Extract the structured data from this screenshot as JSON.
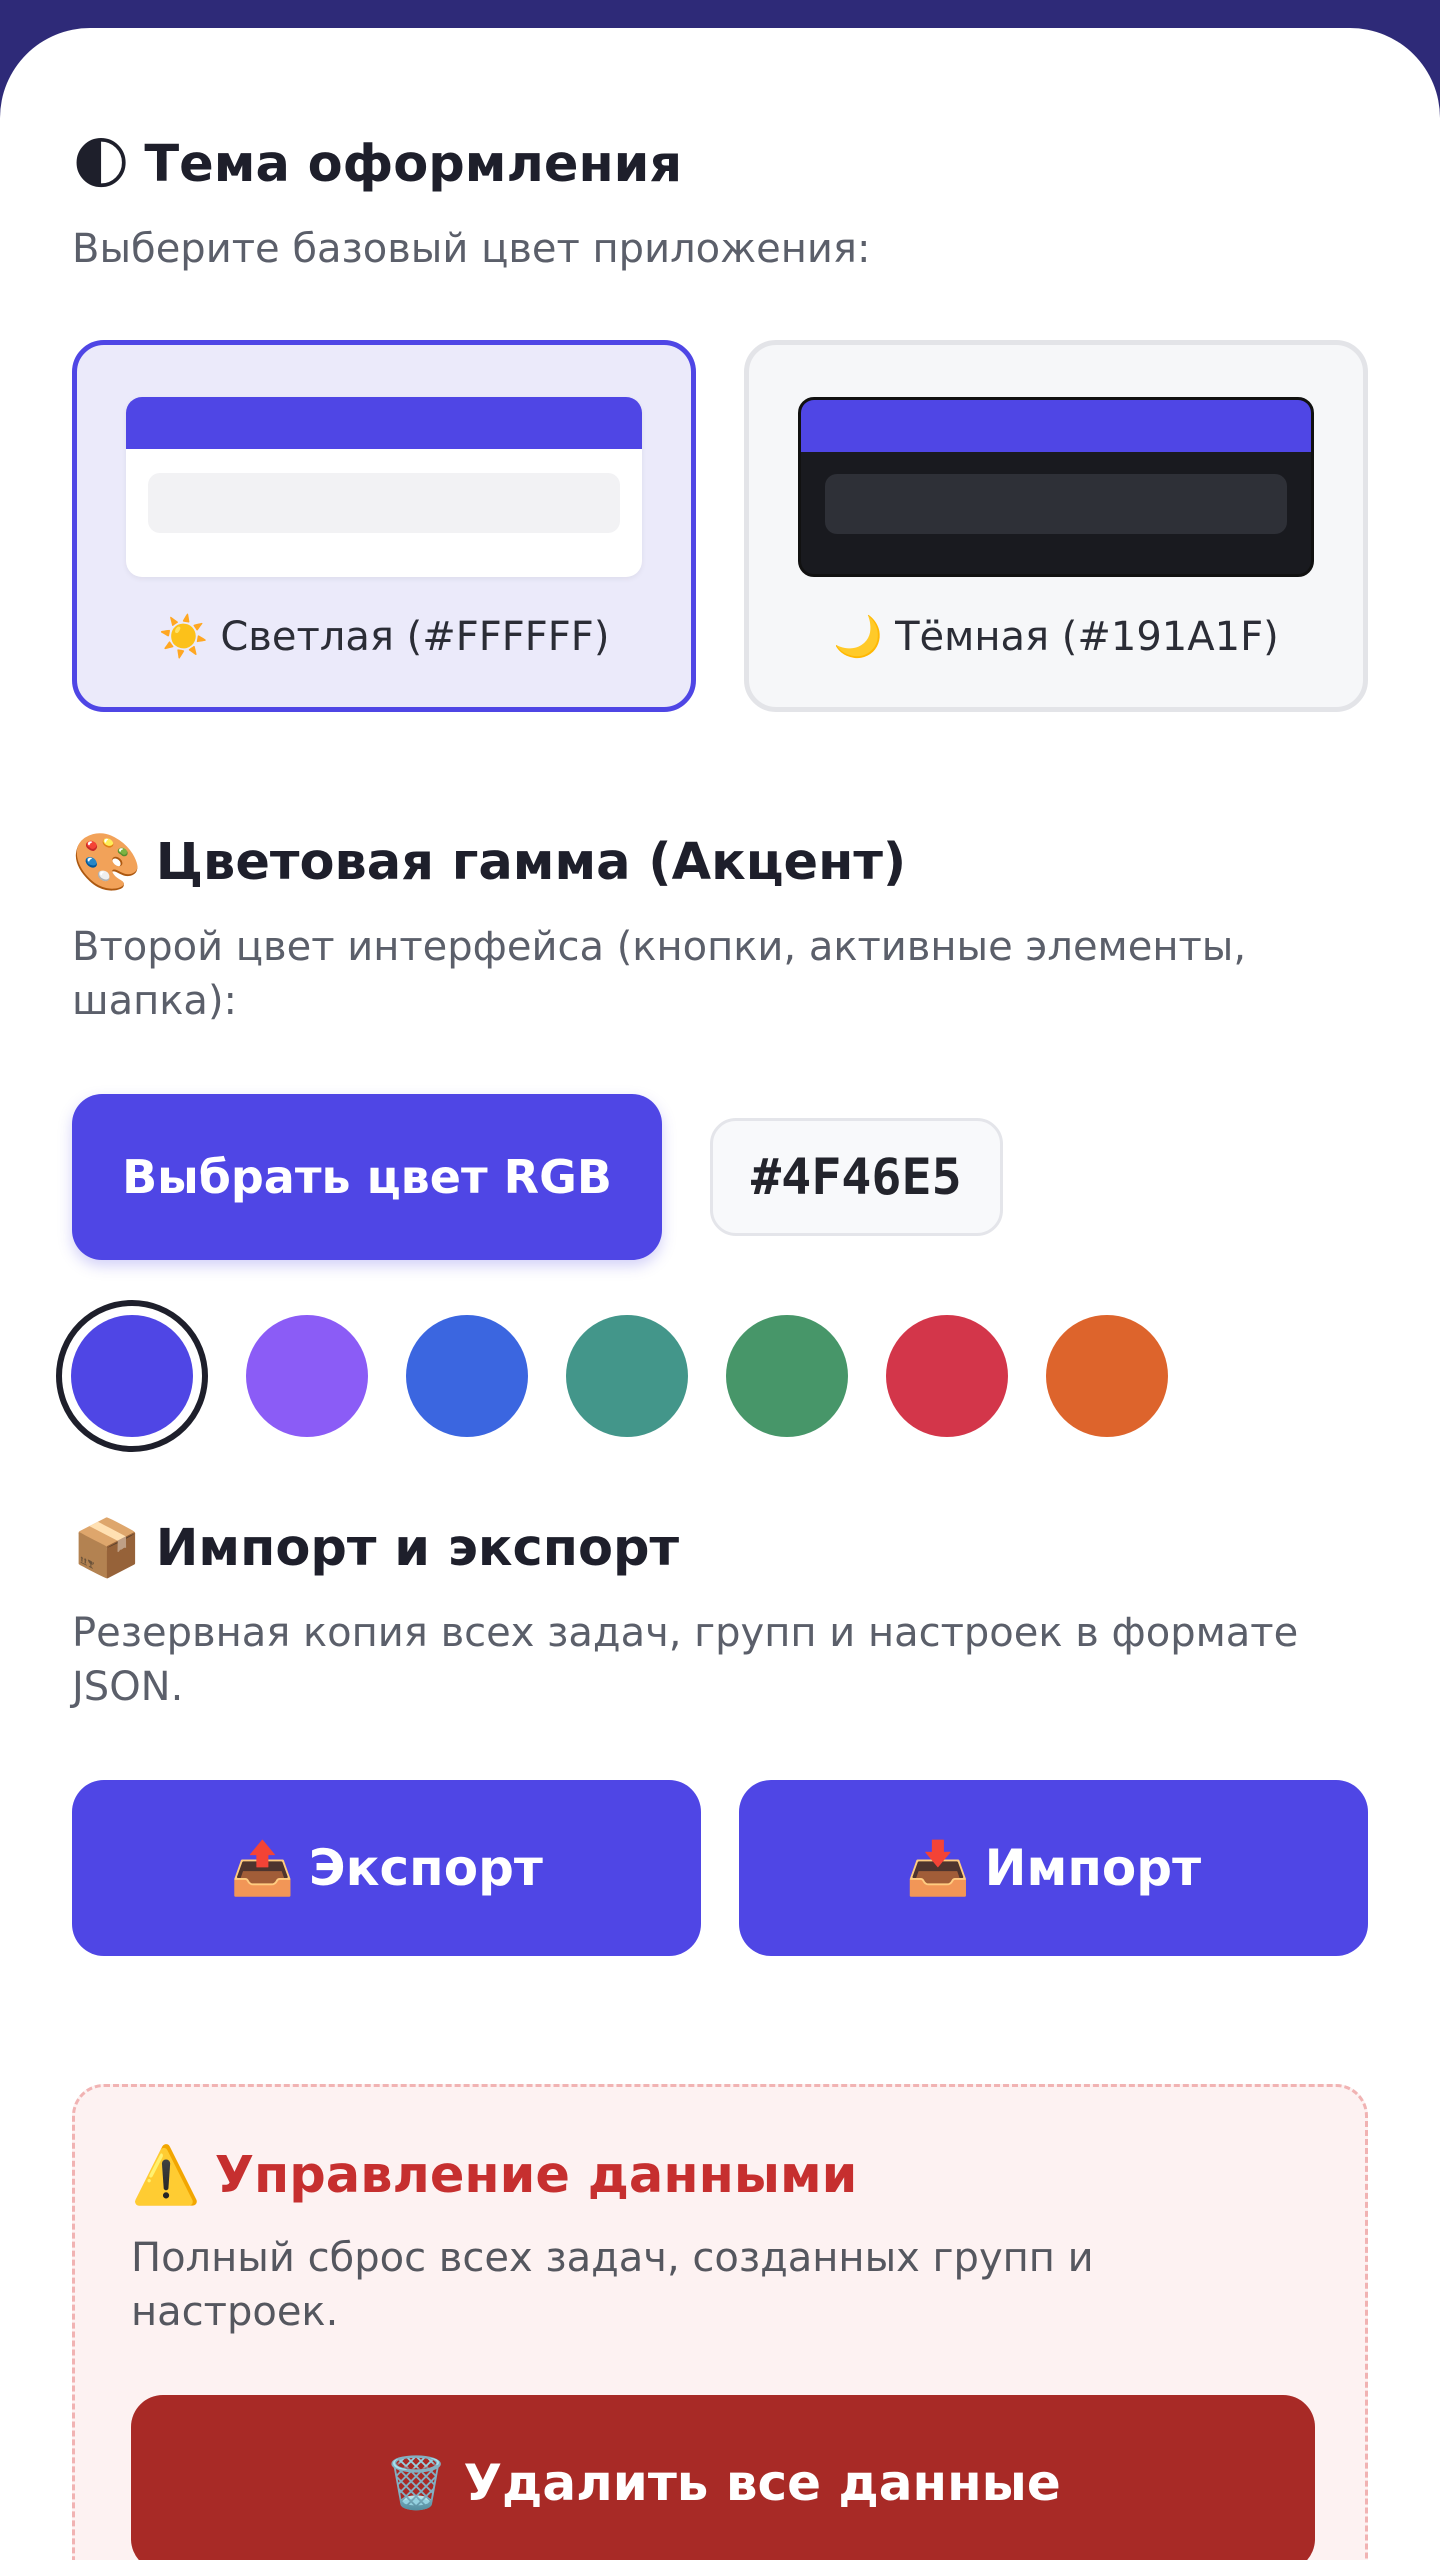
{
  "theme": {
    "icon": "moon-half-icon",
    "icon_glyph": "🌓",
    "title": "Тема оформления",
    "description": "Выберите базовый цвет приложения:",
    "options": [
      {
        "icon": "sun-icon",
        "icon_glyph": "☀️",
        "label": "Светлая (#FFFFFF)",
        "selected": true
      },
      {
        "icon": "moon-icon",
        "icon_glyph": "🌙",
        "label": "Тёмная (#191A1F)",
        "selected": false
      }
    ]
  },
  "accent": {
    "icon": "palette-icon",
    "icon_glyph": "🎨",
    "title": "Цветовая гамма (Акцент)",
    "description": "Второй цвет интерфейса (кнопки, активные элементы, шапка):",
    "pick_button": "Выбрать цвет RGB",
    "current_hex": "#4F46E5",
    "swatches": [
      "#4F46E5",
      "#8B5CF6",
      "#3B66E0",
      "#43968A",
      "#479669",
      "#D3364A",
      "#DD642C"
    ],
    "selected_swatch": 0
  },
  "io": {
    "icon": "package-icon",
    "icon_glyph": "📦",
    "title": "Импорт и экспорт",
    "description": "Резервная копия всех задач, групп и настроек в формате JSON.",
    "export": {
      "icon": "outbox-tray-icon",
      "icon_glyph": "📤",
      "label": "Экспорт"
    },
    "import": {
      "icon": "inbox-tray-icon",
      "icon_glyph": "📥",
      "label": "Импорт"
    }
  },
  "danger": {
    "icon": "warning-icon",
    "icon_glyph": "⚠️",
    "title": "Управление данными",
    "description": "Полный сброс всех задач, созданных групп и настроек.",
    "delete_button": {
      "icon": "trash-icon",
      "icon_glyph": "🗑️",
      "label": "Удалить все данные"
    }
  },
  "colors": {
    "accent": "#4F46E5",
    "light_bg": "#FFFFFF",
    "dark_bg": "#191A1F",
    "danger": "#A82A26"
  }
}
